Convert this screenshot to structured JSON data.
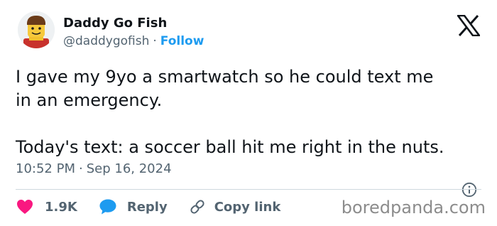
{
  "author": {
    "display_name": "Daddy Go Fish",
    "handle": "@daddygofish",
    "separator": "·",
    "follow_label": "Follow"
  },
  "tweet": {
    "line1": "I gave my 9yo a smartwatch so he could text me",
    "line2": "in an emergency.",
    "line3": "Today's text: a soccer ball hit me right in the nuts."
  },
  "meta": {
    "time": "10:52 PM",
    "separator": "·",
    "date": "Sep 16, 2024"
  },
  "actions": {
    "like_count": "1.9K",
    "reply_label": "Reply",
    "copy_label": "Copy link"
  },
  "watermark": "boredpanda.com",
  "colors": {
    "text": "#0f1419",
    "secondary": "#536471",
    "accent": "#1d9bf0",
    "like": "#f91880",
    "reply": "#1d9bf0",
    "divider": "#cfd9de"
  },
  "icons": {
    "brand": "x-logo-icon",
    "info": "info-icon",
    "like": "heart-icon",
    "reply": "speech-bubble-icon",
    "copy": "link-icon"
  }
}
